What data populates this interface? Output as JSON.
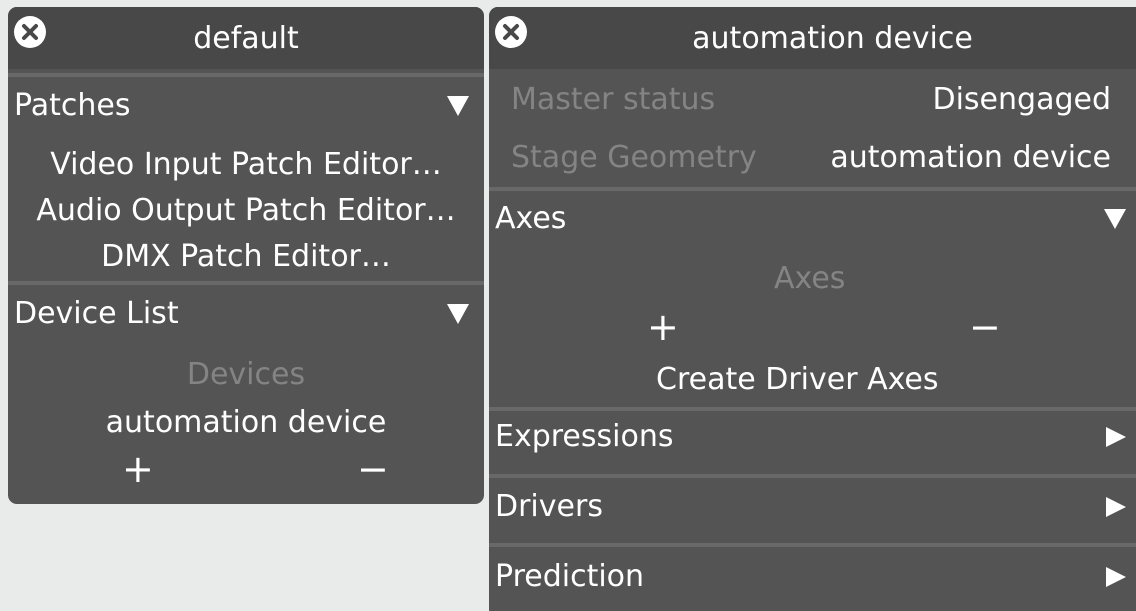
{
  "left_panel": {
    "title": "default",
    "patches": {
      "header": "Patches",
      "items": [
        "Video Input Patch Editor…",
        "Audio Output Patch Editor…",
        "DMX Patch Editor…"
      ]
    },
    "device_list": {
      "header": "Device List",
      "list_label": "Devices",
      "items": [
        "automation device"
      ],
      "add_label": "+",
      "remove_label": "−"
    }
  },
  "right_panel": {
    "title": "automation device",
    "properties": [
      {
        "label": "Master status",
        "value": "Disengaged"
      },
      {
        "label": "Stage Geometry",
        "value": "automation device"
      }
    ],
    "axes": {
      "header": "Axes",
      "list_label": "Axes",
      "add_label": "+",
      "remove_label": "−",
      "create_label": "Create Driver Axes"
    },
    "collapsed_sections": [
      "Expressions",
      "Drivers",
      "Prediction"
    ]
  },
  "icons": {
    "close": "close-icon",
    "expanded": "triangle-down-icon",
    "collapsed": "triangle-right-icon"
  },
  "colors": {
    "background": "#e9eaea",
    "panel": "#545454",
    "title_bar": "#484848",
    "separator": "#686868",
    "text": "#ffffff",
    "dim_text": "#848484"
  }
}
